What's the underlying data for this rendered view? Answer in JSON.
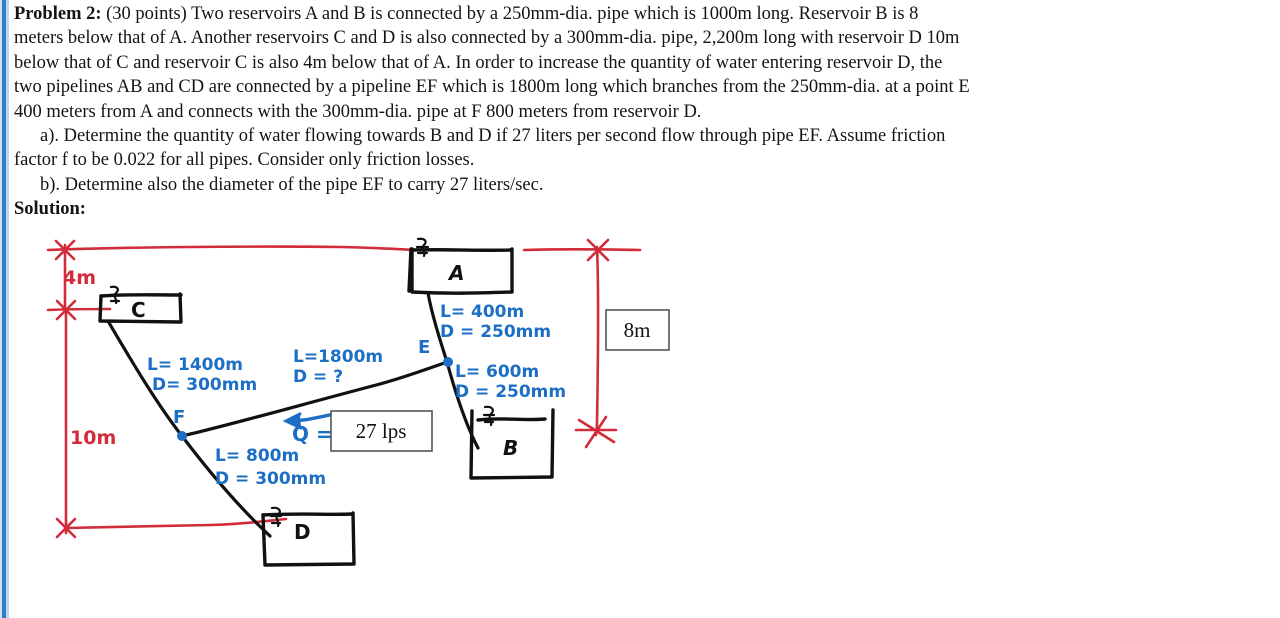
{
  "document": {
    "problem_label": "Problem 2:",
    "points": "(30 points)",
    "body_line1": " Two reservoirs A and B is connected by a 250mm-dia. pipe which is 1000m long.  Reservoir B is 8",
    "body_line2": "meters below that of A.  Another reservoirs C and D is also connected by a 300mm-dia. pipe, 2,200m long with reservoir D 10m",
    "body_line3": "below that of C and reservoir C  is also 4m below that of A.  In order to increase the quantity of water entering reservoir D, the",
    "body_line4": "two pipelines AB and CD are connected by a pipeline EF which is 1800m long which branches from the 250mm-dia. at a point E",
    "body_line5": "400 meters from A and connects with the 300mm-dia. pipe at F 800 meters from reservoir D.",
    "part_a": "a). Determine the quantity of water flowing towards B and D if 27 liters per second flow through pipe EF.  Assume friction",
    "part_a_cont": "factor f to be 0.022 for all pipes.  Consider only friction losses.",
    "part_b": "b). Determine also the diameter of the pipe EF to carry 27 liters/sec.",
    "solution_label": "Solution:"
  },
  "diagram": {
    "reservoirs": {
      "a": "A",
      "b": "B",
      "c": "C",
      "d": "D"
    },
    "nodes": {
      "e": "E",
      "f": "F"
    },
    "pipe_labels": {
      "cf_length": "L= 1400m",
      "cf_diameter": "D= 300mm",
      "ae_length": "L= 400m",
      "ae_diameter": "D = 250mm",
      "eb_length": "L= 600m",
      "eb_diameter": "D = 250mm",
      "ef_length": "L=1800m",
      "ef_diameter": "D = ?",
      "fd_length": "L= 800m",
      "fd_diameter": "D = 300mm"
    },
    "flow": {
      "q_symbol": "Q =",
      "q_value": "27 lps"
    },
    "elevations": {
      "a_to_c": "4m",
      "c_to_d": "10m",
      "a_to_b": "8m"
    },
    "colors": {
      "handwriting_blue": "#1c6fc4",
      "datum_red": "#d22b3a",
      "ink_black": "#111111",
      "box_border": "#555555",
      "page_edge_blue": "#2f7fc6"
    }
  }
}
